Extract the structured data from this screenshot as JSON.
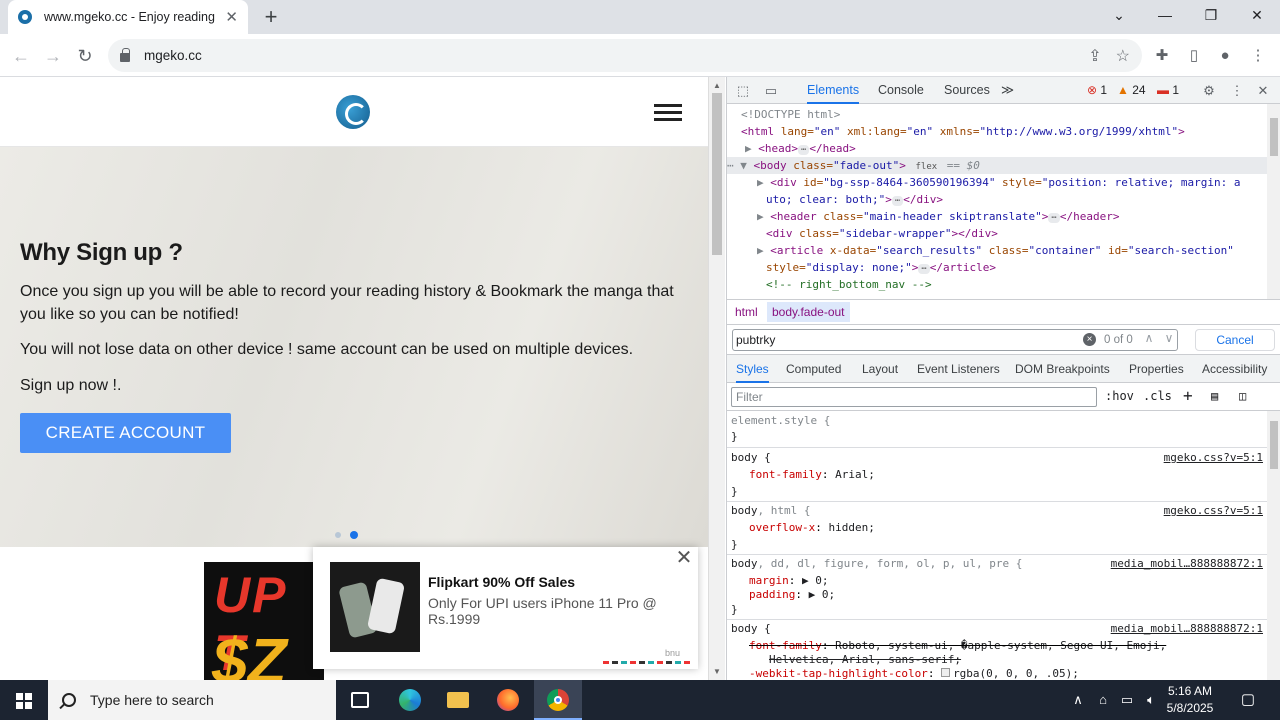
{
  "browser": {
    "tab_title": "www.mgeko.cc - Enjoy reading",
    "url": "mgeko.cc",
    "new_tab_symbol": "+",
    "tab_close_symbol": "✕",
    "window_controls": [
      "⌄",
      "—",
      "❐",
      "✕"
    ]
  },
  "page": {
    "hero_title": "Why Sign up ?",
    "hero_p1": "Once you sign up you will be able to record your reading history & Bookmark the manga that you like so you can be notified!",
    "hero_p2": "You will not lose data on other device ! same account can be used on multiple devices.",
    "hero_p3": "Sign up now !.",
    "create_account": "CREATE ACCOUNT",
    "carousel_active_index": 1,
    "banner_line1": "UP T",
    "banner_line2": "$Z"
  },
  "ad": {
    "title": "Flipkart 90% Off Sales",
    "description": "Only For UPI users iPhone 11 Pro @ Rs.1999",
    "brand": "bnu",
    "close_symbol": "✕"
  },
  "devtools": {
    "tabs": [
      "Elements",
      "Console",
      "Sources"
    ],
    "more_tabs": "≫",
    "errors": "1",
    "warnings": "24",
    "issues": "1",
    "dom_lines": {
      "l1": "<!DOCTYPE html>",
      "l2_tag_open": "<html ",
      "l2_attr1": "lang=",
      "l2_val1": "\"en\"",
      "l2_attr2": " xml:lang=",
      "l2_val2": "\"en\"",
      "l2_attr3": " xmlns=",
      "l2_val3": "\"http://www.w3.org/1999/xhtml\"",
      "l2_tag_close": ">",
      "l3_open": "<head>",
      "l3_close": "</head>",
      "l4_open": "<body ",
      "l4_attr": "class=",
      "l4_val": "\"fade-out\"",
      "l4_close": ">",
      "l4_badge": "flex",
      "l4_eq": "== $0",
      "l5_open": "<div ",
      "l5_attr1": "id=",
      "l5_val1": "\"bg-ssp-8464-360590196394\"",
      "l5_attr2": " style=",
      "l5_val2a": "\"position: relative; margin: a",
      "l6_val2b": "uto; clear: both;\"",
      "l6_close": "</div>",
      "l7_open": "<header ",
      "l7_attr": "class=",
      "l7_val": "\"main-header skiptranslate\"",
      "l7_close": "</header>",
      "l8_open": "<div ",
      "l8_attr": "class=",
      "l8_val": "\"sidebar-wrapper\"",
      "l8_close": "></div>",
      "l9_open": "<article ",
      "l9_attr1": "x-data=",
      "l9_val1": "\"search_results\"",
      "l9_attr2": " class=",
      "l9_val2": "\"container\"",
      "l9_attr3": " id=",
      "l9_val3": "\"search-section\"",
      "l10_attr": "style=",
      "l10_val": "\"display: none;\"",
      "l10_close": "</article>",
      "l11": "<!-- right_bottom_nav -->"
    },
    "breadcrumb": [
      "html",
      "body.fade-out"
    ],
    "search_value": "pubtrky",
    "search_count": "0 of 0",
    "search_cancel": "Cancel",
    "subtabs": [
      "Styles",
      "Computed",
      "Layout",
      "Event Listeners",
      "DOM Breakpoints",
      "Properties",
      "Accessibility"
    ],
    "filter_placeholder": "Filter",
    "filter_tools": [
      ":hov",
      ".cls"
    ],
    "styles": {
      "r0_sel": "element.style {",
      "r0_close": "}",
      "r1_sel": "body {",
      "r1_src": "mgeko.css?v=5:1",
      "r1_p": "font-family",
      "r1_v": "Arial;",
      "r1_close": "}",
      "r2_sel": "body",
      "r2_sel_rest": ", html {",
      "r2_src": "mgeko.css?v=5:1",
      "r2_p": "overflow-x",
      "r2_v": "hidden;",
      "r2_close": "}",
      "r3_sel": "body",
      "r3_sel_rest": ", dd, dl, figure, form, ol, p, ul, pre {",
      "r3_src": "media_mobil…888888872:1",
      "r3_p1": "margin",
      "r3_v1": "▶ 0;",
      "r3_p2": "padding",
      "r3_v2": "▶ 0;",
      "r3_close": "}",
      "r4_sel": "body {",
      "r4_src": "media_mobil…888888872:1",
      "r4_p1": "font-family",
      "r4_v1": "Roboto, system-ui, �apple-system, Segoe UI, Emoji,",
      "r4_v1b": "Helvetica, Arial, sans-serif;",
      "r4_p2": "-webkit-tap-highlight-color",
      "r4_v2": "rgba(0, 0, 0, .05);"
    }
  },
  "taskbar": {
    "search_placeholder": "Type here to search",
    "time": "5:16 AM",
    "date": "5/8/2025"
  },
  "colors": {
    "accent": "#1a73e8",
    "create_button": "#4a8ff5",
    "taskbar": "#1c2431"
  }
}
